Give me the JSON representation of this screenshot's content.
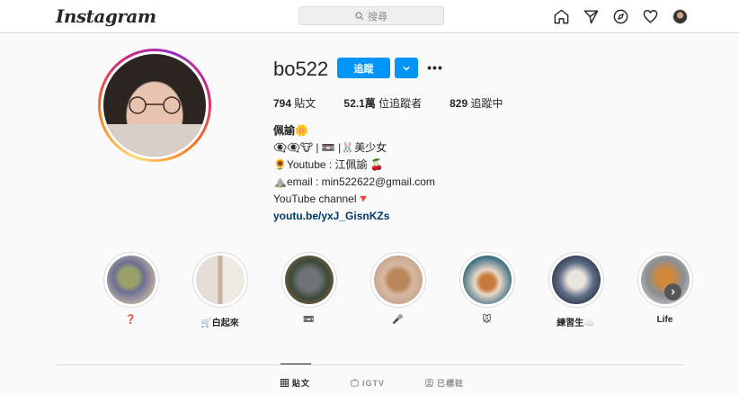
{
  "nav": {
    "logo": "Instagram",
    "search_placeholder": "搜尋",
    "icons": [
      "home-icon",
      "direct-icon",
      "explore-icon",
      "activity-icon",
      "profile-avatar"
    ]
  },
  "profile": {
    "username": "bo522",
    "follow_label": "追蹤",
    "stats": {
      "posts_count": "794",
      "posts_label": "貼文",
      "followers_count": "52.1萬",
      "followers_label": "位追蹤者",
      "following_count": "829",
      "following_label": "追蹤中"
    },
    "bio": {
      "name": "佩諭🌼",
      "line1": "👁️‍🗨️👁️‍🗨️🐮 | 📼 |🐰美少女",
      "line2": "🌻Youtube : 江佩諭 🍒",
      "line3": "⛰️email : min522622@gmail.com",
      "line4": "YouTube channel🔻",
      "link": "youtu.be/yxJ_GisnKZs"
    }
  },
  "highlights": [
    {
      "label": "❓"
    },
    {
      "label": "🛒白起來"
    },
    {
      "label": "📼"
    },
    {
      "label": "🎤"
    },
    {
      "label": "🐭"
    },
    {
      "label": "練習生☁️"
    },
    {
      "label": "Life"
    }
  ],
  "tabs": [
    {
      "label": "貼文",
      "icon": "grid-icon",
      "active": true
    },
    {
      "label": "IGTV",
      "icon": "igtv-icon",
      "active": false
    },
    {
      "label": "已標註",
      "icon": "tagged-icon",
      "active": false
    }
  ],
  "colors": {
    "accent": "#0095f6",
    "link": "#00376b"
  }
}
